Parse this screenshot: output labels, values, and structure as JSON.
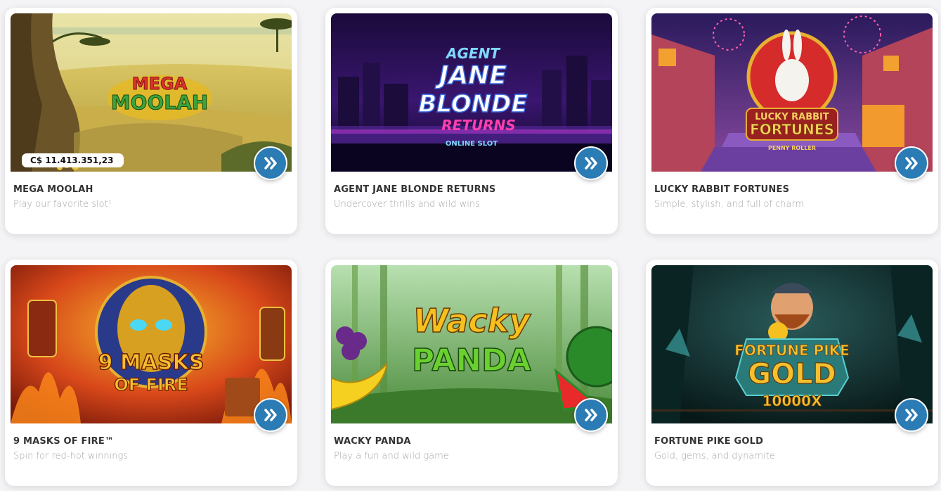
{
  "games": [
    {
      "title": "MEGA MOOLAH",
      "subtitle": "Play our favorite slot!",
      "jackpot": "C$ 11.413.351,23",
      "logo": [
        "MEGA",
        "MOOLAH"
      ]
    },
    {
      "title": "AGENT JANE BLONDE RETURNS",
      "subtitle": "Undercover thrills and wild wins",
      "logo": [
        "AGENT",
        "JANE",
        "BLONDE",
        "RETURNS",
        "ONLINE SLOT"
      ]
    },
    {
      "title": "LUCKY RABBIT FORTUNES",
      "subtitle": "Simple, stylish, and full of charm",
      "logo": [
        "LUCKY RABBIT",
        "FORTUNES",
        "PENNY ROLLER"
      ]
    },
    {
      "title": "9 MASKS OF FIRE™",
      "subtitle": "Spin for red-hot winnings",
      "logo": [
        "9 MASKS",
        "OF FIRE"
      ]
    },
    {
      "title": "WACKY PANDA",
      "subtitle": "Play a fun and wild game",
      "logo": [
        "Wacky",
        "PANDA"
      ]
    },
    {
      "title": "FORTUNE PIKE GOLD",
      "subtitle": "Gold, gems, and dynamite",
      "logo": [
        "FORTUNE PIKE",
        "GOLD",
        "10000X"
      ]
    }
  ],
  "icons": {
    "play": "double-chevron-right-icon"
  },
  "colors": {
    "play_button": "#2b7bb5",
    "card_bg": "#ffffff",
    "page_bg": "#f4f4f6"
  }
}
